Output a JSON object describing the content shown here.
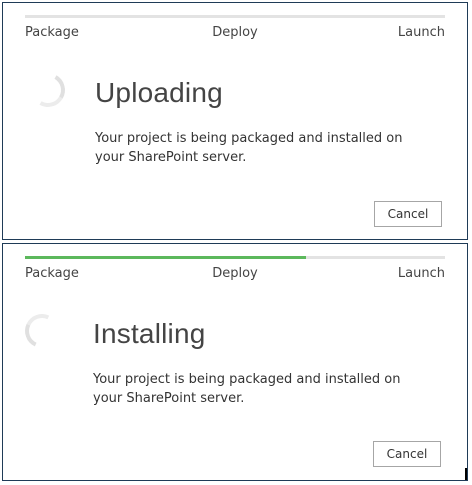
{
  "steps": [
    "Package",
    "Deploy",
    "Launch"
  ],
  "dialogs": [
    {
      "title": "Uploading",
      "description": "Your project is being packaged and installed on your SharePoint server.",
      "cancel_label": "Cancel",
      "progress": 0
    },
    {
      "title": "Installing",
      "description": "Your project is being packaged and installed on your SharePoint server.",
      "cancel_label": "Cancel",
      "progress": 0.67
    }
  ],
  "colors": {
    "progress": "#5cb85c",
    "track": "#e3e3e3",
    "border": "#1f3b57"
  },
  "icons": {
    "spinner": "loading-spinner-icon"
  }
}
